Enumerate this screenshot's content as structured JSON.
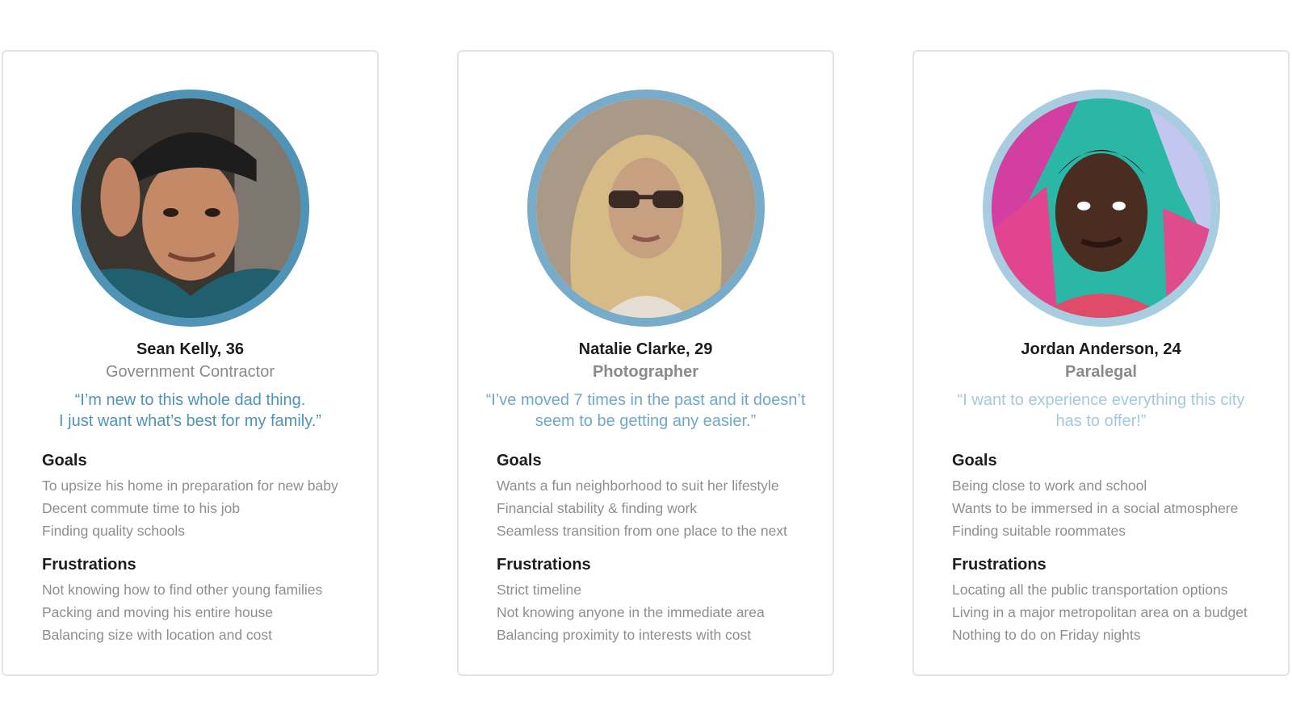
{
  "personas": [
    {
      "name": "Sean Kelly, 36",
      "role": "Government Contractor",
      "quote_lines": [
        "“I’m new to this whole dad thing.",
        "I just want what’s best for my family.”"
      ],
      "quote_color": "#4f93b6",
      "ring_color": "#4f93b6",
      "goals_label": "Goals",
      "goals": [
        "To upsize his home in preparation for new baby",
        "Decent commute time to his job",
        "Finding quality schools"
      ],
      "frustrations_label": "Frustrations",
      "frustrations": [
        "Not knowing how to find other young families",
        "Packing and moving his entire house",
        "Balancing size with location and cost"
      ]
    },
    {
      "name": "Natalie Clarke, 29",
      "role": "Photographer",
      "quote_lines": [
        "“I’ve moved 7 times in the past and it doesn’t",
        "seem to be getting any easier.”"
      ],
      "quote_color": "#70a9c8",
      "ring_color": "#76abc9",
      "goals_label": "Goals",
      "goals": [
        "Wants a fun neighborhood to suit her lifestyle",
        "Financial stability & finding work",
        "Seamless transition from one place to the next"
      ],
      "frustrations_label": "Frustrations",
      "frustrations": [
        "Strict timeline",
        "Not knowing anyone in the immediate area",
        "Balancing proximity to interests with cost"
      ]
    },
    {
      "name": "Jordan Anderson, 24",
      "role": "Paralegal",
      "quote_lines": [
        "“I want to experience everything this city",
        "has to offer!”"
      ],
      "quote_color": "#a5c9dd",
      "ring_color": "#a9cde0",
      "goals_label": "Goals",
      "goals": [
        "Being close to work and school",
        "Wants to be immersed in a social atmosphere",
        "Finding suitable roommates"
      ],
      "frustrations_label": "Frustrations",
      "frustrations": [
        "Locating all the public transportation options",
        "Living in a major metropolitan area on a budget",
        "Nothing to do on Friday nights"
      ]
    }
  ]
}
